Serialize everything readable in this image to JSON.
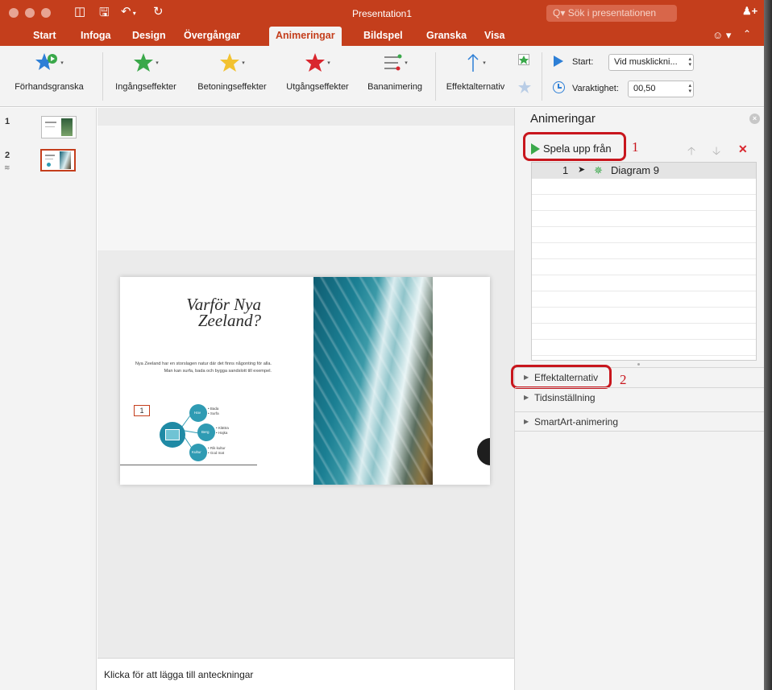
{
  "window": {
    "title": "Presentation1",
    "search_placeholder": "Sök i presentationen"
  },
  "tabs": [
    {
      "label": "Start"
    },
    {
      "label": "Infoga"
    },
    {
      "label": "Design"
    },
    {
      "label": "Övergångar"
    },
    {
      "label": "Animeringar",
      "active": true
    },
    {
      "label": "Bildspel"
    },
    {
      "label": "Granska"
    },
    {
      "label": "Visa"
    }
  ],
  "ribbon": {
    "preview": "Förhandsgranska",
    "entrance": "Ingångseffekter",
    "emphasis": "Betoningseffekter",
    "exit": "Utgångseffekter",
    "path": "Bananimering",
    "effect_options": "Effektalternativ",
    "start_label": "Start:",
    "start_value": "Vid musklickni...",
    "duration_label": "Varaktighet:",
    "duration_value": "00,50"
  },
  "thumbnails": [
    {
      "number": "1"
    },
    {
      "number": "2",
      "selected": true
    }
  ],
  "slide": {
    "title": "Varför Nya Zeeland?",
    "body": "Nya Zeeland har en storslagen natur där det finns någonting för alla. Man kan surfa, bada och bygga sandslott till exempel.",
    "animation_tag": "1",
    "smartart": {
      "b1_title": "Hav",
      "b1_items": [
        "• Bada",
        "• Surfa"
      ],
      "b2_title": "Berg",
      "b2_items": [
        "• Klättra",
        "• Hajka"
      ],
      "b3_title": "Kultur",
      "b3_items": [
        "• Rik kultur",
        "• God mat"
      ]
    }
  },
  "notes": {
    "placeholder": "Klicka för att lägga till anteckningar"
  },
  "animation_pane": {
    "title": "Animeringar",
    "play_from": "Spela upp från",
    "annotation_1": "1",
    "annotation_2": "2",
    "items": [
      {
        "order": "1",
        "name": "Diagram 9"
      }
    ],
    "sections": [
      "Effektalternativ",
      "Tidsinställning",
      "SmartArt-animering"
    ]
  },
  "colors": {
    "accent": "#c43e1c",
    "entrance": "#3aa84a",
    "emphasis": "#f2c230",
    "exit": "#d9262e",
    "annotation": "#c8161d"
  }
}
